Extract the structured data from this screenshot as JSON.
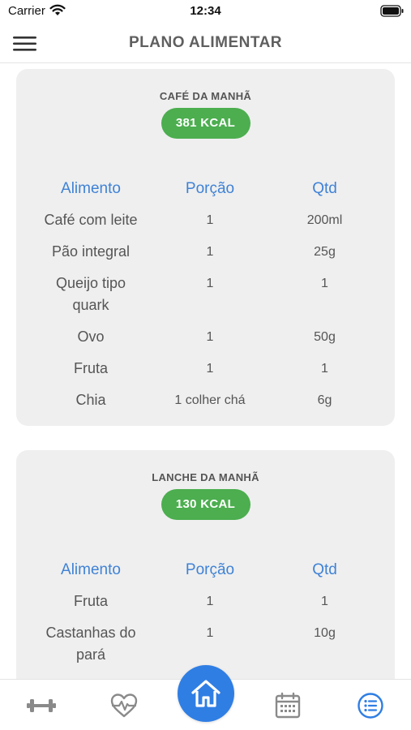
{
  "status": {
    "carrier": "Carrier",
    "time": "12:34"
  },
  "header": {
    "title": "PLANO ALIMENTAR"
  },
  "meals": [
    {
      "title": "CAFÉ DA MANHÃ",
      "kcal": "381 KCAL",
      "columns": [
        "Alimento",
        "Porção",
        "Qtd"
      ],
      "rows": [
        [
          "Café com leite",
          "1",
          "200ml"
        ],
        [
          "Pão integral",
          "1",
          "25g"
        ],
        [
          "Queijo tipo quark",
          "1",
          "1"
        ],
        [
          "Ovo",
          "1",
          "50g"
        ],
        [
          "Fruta",
          "1",
          "1"
        ],
        [
          "Chia",
          "1 colher chá",
          "6g"
        ]
      ]
    },
    {
      "title": "LANCHE DA MANHÃ",
      "kcal": "130 KCAL",
      "columns": [
        "Alimento",
        "Porção",
        "Qtd"
      ],
      "rows": [
        [
          "Fruta",
          "1",
          "1"
        ],
        [
          "Castanhas do pará",
          "1",
          "10g"
        ]
      ]
    }
  ],
  "nav": {
    "items": [
      "dumbbell-icon",
      "heart-rate-icon",
      "home-icon",
      "calendar-icon",
      "list-icon"
    ],
    "active": "list-icon",
    "active_color": "#2f7ee4",
    "inactive_color": "#8a8a8a"
  },
  "colors": {
    "accent": "#2f7ee4",
    "kcal_badge": "#4cae4f",
    "table_header": "#3f82d6",
    "card_bg": "#efefef"
  }
}
